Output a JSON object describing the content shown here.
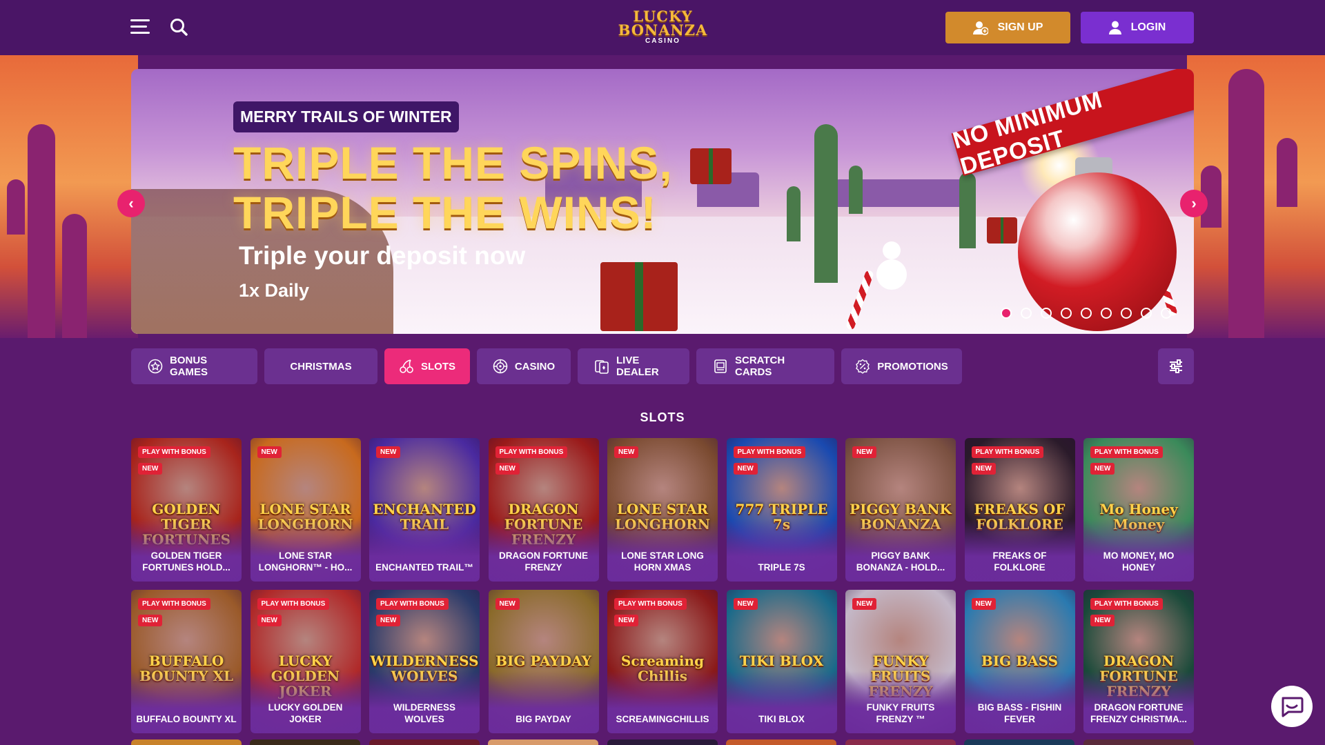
{
  "header": {
    "logo_line1": "LUCKY",
    "logo_line2": "BONANZA",
    "logo_line3": "CASINO",
    "signup_label": "SIGN UP",
    "login_label": "LOGIN"
  },
  "banner": {
    "tag": "MERRY TRAILS OF WINTER",
    "headline_1": "TRIPLE THE SPINS,",
    "headline_2": "TRIPLE THE WINS!",
    "subline": "Triple your deposit now",
    "frequency": "1x Daily",
    "ribbon": "NO MINIMUM DEPOSIT",
    "slide_count": 9,
    "active_slide": 1
  },
  "tabs": [
    {
      "label": "BONUS GAMES",
      "icon": "star-badge-icon"
    },
    {
      "label": "CHRISTMAS",
      "icon": "none"
    },
    {
      "label": "SLOTS",
      "icon": "cherries-icon",
      "active": true
    },
    {
      "label": "CASINO",
      "icon": "roulette-icon"
    },
    {
      "label": "LIVE DEALER",
      "icon": "cards-icon"
    },
    {
      "label": "SCRATCH CARDS",
      "icon": "ticket-icon"
    },
    {
      "label": "PROMOTIONS",
      "icon": "percent-badge-icon"
    }
  ],
  "section_title": "SLOTS",
  "games": [
    {
      "name": "GOLDEN TIGER FORTUNES HOLD...",
      "art": "GOLDEN TIGER FORTUNES",
      "badges": [
        "PLAY WITH BONUS",
        "NEW"
      ],
      "color": "#a8241c"
    },
    {
      "name": "LONE STAR LONGHORN™ - HO...",
      "art": "LONE STAR LONGHORN",
      "badges": [
        "NEW"
      ],
      "color": "#c86a1e"
    },
    {
      "name": "ENCHANTED TRAIL™",
      "art": "ENCHANTED TRAIL",
      "badges": [
        "NEW"
      ],
      "color": "#4a2aa0"
    },
    {
      "name": "DRAGON FORTUNE FRENZY",
      "art": "DRAGON FORTUNE FRENZY",
      "badges": [
        "PLAY WITH BONUS",
        "NEW"
      ],
      "color": "#9a1a1a"
    },
    {
      "name": "LONE STAR LONG HORN XMAS",
      "art": "LONE STAR LONGHORN",
      "badges": [
        "NEW"
      ],
      "color": "#7a4a30"
    },
    {
      "name": "TRIPLE 7S",
      "art": "777 TRIPLE 7s",
      "badges": [
        "PLAY WITH BONUS",
        "NEW"
      ],
      "color": "#1a4ab0"
    },
    {
      "name": "PIGGY BANK BONANZA - HOLD...",
      "art": "PIGGY BANK BONANZA",
      "badges": [
        "NEW"
      ],
      "color": "#7a5040"
    },
    {
      "name": "FREAKS OF FOLKLORE",
      "art": "FREAKS OF FOLKLORE",
      "badges": [
        "PLAY WITH BONUS",
        "NEW"
      ],
      "color": "#2a1a2a"
    },
    {
      "name": "MO MONEY, MO HONEY",
      "art": "Mo Honey Money",
      "badges": [
        "PLAY WITH BONUS",
        "NEW"
      ],
      "color": "#3a8a5a"
    },
    {
      "name": "BUFFALO BOUNTY XL",
      "art": "BUFFALO BOUNTY XL",
      "badges": [
        "PLAY WITH BONUS",
        "NEW"
      ],
      "color": "#9a5a2a"
    },
    {
      "name": "LUCKY GOLDEN JOKER",
      "art": "LUCKY GOLDEN JOKER",
      "badges": [
        "PLAY WITH BONUS",
        "NEW"
      ],
      "color": "#b02a2a"
    },
    {
      "name": "WILDERNESS WOLVES",
      "art": "WILDERNESS WOLVES",
      "badges": [
        "PLAY WITH BONUS",
        "NEW"
      ],
      "color": "#2a3a6a"
    },
    {
      "name": "BIG PAYDAY",
      "art": "BIG PAYDAY",
      "badges": [
        "NEW"
      ],
      "color": "#8a6a2a"
    },
    {
      "name": "SCREAMINGCHILLIS",
      "art": "Screaming Chillis",
      "badges": [
        "PLAY WITH BONUS",
        "NEW"
      ],
      "color": "#8a1a1a"
    },
    {
      "name": "TIKI BLOX",
      "art": "TIKI BLOX",
      "badges": [
        "NEW"
      ],
      "color": "#1a6a8a"
    },
    {
      "name": "FUNKY FRUITS FRENZY ™",
      "art": "FUNKY FRUITS FRENZY",
      "badges": [
        "NEW"
      ],
      "color": "#c4b8c8"
    },
    {
      "name": "BIG BASS - FISHIN FEVER",
      "art": "BIG BASS",
      "badges": [
        "NEW"
      ],
      "color": "#2a7ab0"
    },
    {
      "name": "DRAGON FORTUNE FRENZY CHRISTMA...",
      "art": "DRAGON FORTUNE FRENZY",
      "badges": [
        "PLAY WITH BONUS",
        "NEW"
      ],
      "color": "#1a4a3a"
    }
  ]
}
